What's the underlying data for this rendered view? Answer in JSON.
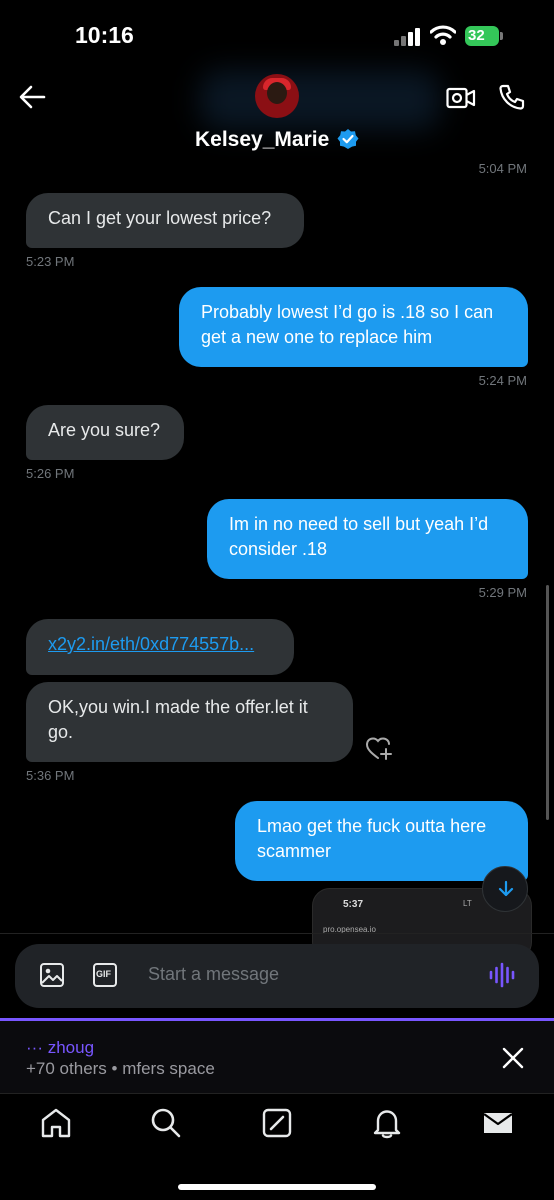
{
  "status_bar": {
    "time": "10:16",
    "battery": "32"
  },
  "header": {
    "contact_name": "Kelsey_Marie"
  },
  "messages": [
    {
      "time": "5:04 PM"
    },
    {
      "text": "Can I get your lowest price?",
      "time": "5:23 PM"
    },
    {
      "text": "Probably lowest I’d go is .18 so I can get a new one to replace him",
      "time": "5:24 PM"
    },
    {
      "text": "Are you sure?",
      "time": "5:26 PM"
    },
    {
      "text": "Im in no need to sell but yeah I’d consider .18",
      "time": "5:29 PM"
    },
    {
      "link": "x2y2.in/eth/0xd774557b..."
    },
    {
      "text": "OK,you win.I made the offer.let it go.",
      "time": "5:36 PM"
    },
    {
      "text": "Lmao get the fuck outta here scammer"
    }
  ],
  "attachment": {
    "time": "5:37",
    "url": "pro.opensea.io",
    "status": "LT"
  },
  "composer": {
    "placeholder": "Start a message",
    "gif_label": "GIF"
  },
  "spaces": {
    "host": "··· zhoug",
    "info": "+70 others • mfers space"
  },
  "colors": {
    "accent": "#1d9bf0",
    "spaces": "#7856ff",
    "incoming_bubble": "#2f3336",
    "battery": "#34c759"
  },
  "icons": [
    "back-arrow-icon",
    "verified-icon",
    "video-call-icon",
    "phone-icon",
    "add-reaction-icon",
    "scroll-down-icon",
    "image-icon",
    "gif-icon",
    "voice-icon",
    "close-icon",
    "home-icon",
    "search-icon",
    "grok-icon",
    "notifications-icon",
    "messages-icon"
  ]
}
